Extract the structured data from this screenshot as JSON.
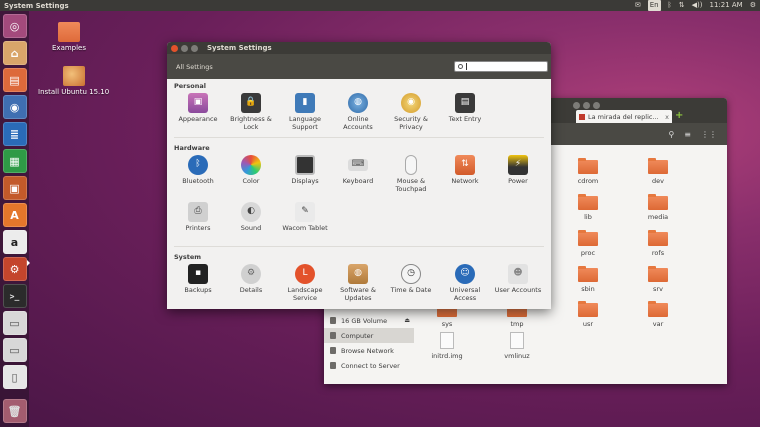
{
  "top_panel": {
    "title": "System Settings",
    "keyboard": "En",
    "volume": "◀))",
    "time": "11:21 AM"
  },
  "desktop": {
    "icons": [
      {
        "label": "Examples"
      },
      {
        "label": "Install Ubuntu 15.10"
      }
    ]
  },
  "file_manager": {
    "tab_title": "La mirada del replic...",
    "tab_close": "x",
    "new_tab": "+",
    "toolbar": {
      "search": "⚲",
      "list": "≡",
      "grid": "⋮⋮"
    },
    "sidebar": [
      {
        "label": "16 GB Volume",
        "selected": false,
        "eject": "⏏"
      },
      {
        "label": "Computer",
        "selected": true
      },
      {
        "label": "Browse Network",
        "selected": false
      },
      {
        "label": "Connect to Server",
        "selected": false
      }
    ],
    "folders": [
      {
        "label": "cdrom"
      },
      {
        "label": "dev"
      },
      {
        "label": "lib"
      },
      {
        "label": "media"
      },
      {
        "label": "proc"
      },
      {
        "label": "rofs"
      },
      {
        "label": "sbin"
      },
      {
        "label": "srv"
      },
      {
        "label": "sys"
      },
      {
        "label": "tmp"
      },
      {
        "label": "usr"
      },
      {
        "label": "var"
      },
      {
        "label": "initrd.img"
      },
      {
        "label": "vmlinuz"
      }
    ]
  },
  "settings": {
    "window_title": "System Settings",
    "all_settings": "All Settings",
    "search_placeholder": "",
    "sections": {
      "personal": "Personal",
      "hardware": "Hardware",
      "system": "System"
    },
    "personal": [
      {
        "label": "Appearance",
        "label2": ""
      },
      {
        "label": "Brightness &",
        "label2": "Lock"
      },
      {
        "label": "Language",
        "label2": "Support"
      },
      {
        "label": "Online",
        "label2": "Accounts"
      },
      {
        "label": "Security &",
        "label2": "Privacy"
      },
      {
        "label": "Text Entry",
        "label2": ""
      }
    ],
    "hardware": [
      {
        "label": "Bluetooth",
        "label2": ""
      },
      {
        "label": "Color",
        "label2": ""
      },
      {
        "label": "Displays",
        "label2": ""
      },
      {
        "label": "Keyboard",
        "label2": ""
      },
      {
        "label": "Mouse &",
        "label2": "Touchpad"
      },
      {
        "label": "Network",
        "label2": ""
      },
      {
        "label": "Power",
        "label2": ""
      },
      {
        "label": "Printers",
        "label2": ""
      },
      {
        "label": "Sound",
        "label2": ""
      },
      {
        "label": "Wacom Tablet",
        "label2": ""
      }
    ],
    "system": [
      {
        "label": "Backups",
        "label2": ""
      },
      {
        "label": "Details",
        "label2": ""
      },
      {
        "label": "Landscape",
        "label2": "Service"
      },
      {
        "label": "Software &",
        "label2": "Updates"
      },
      {
        "label": "Time & Date",
        "label2": ""
      },
      {
        "label": "Universal",
        "label2": "Access"
      },
      {
        "label": "User Accounts",
        "label2": ""
      }
    ]
  },
  "colors": {
    "accent": "#e3522b",
    "panel": "#3b3a37"
  }
}
